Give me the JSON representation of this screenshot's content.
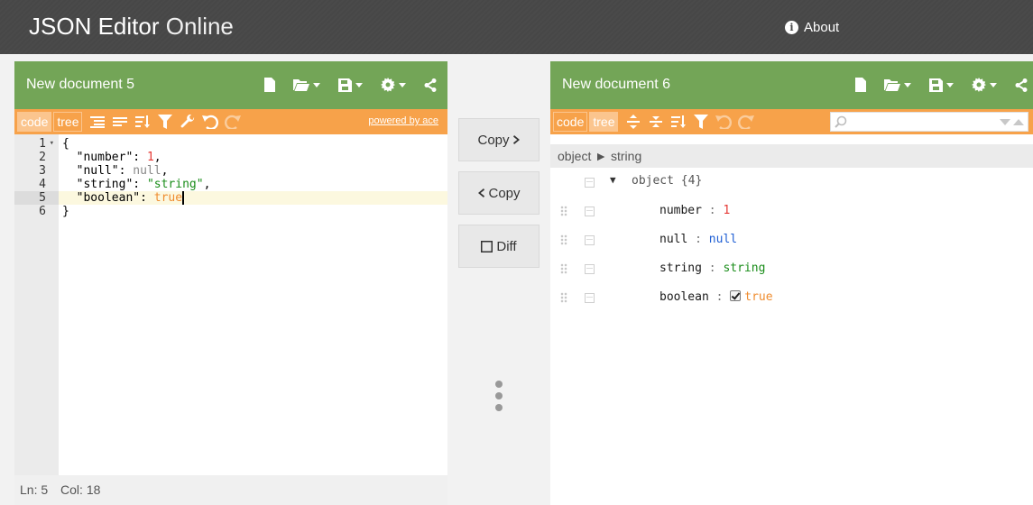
{
  "app": {
    "title_bold": "JSON Editor",
    "title_light": "Online",
    "about_label": "About",
    "info_icon": "info-circle-icon"
  },
  "colors": {
    "header_bg": "#4a4a4a",
    "titlebar_green": "#73a557",
    "toolbar_orange": "#f7a24a",
    "panel_bg": "#f2f2f2"
  },
  "left": {
    "doc_title": "New document 5",
    "toolbar_icons": [
      "new-document-icon",
      "open-folder-icon",
      "save-icon",
      "settings-icon",
      "share-icon"
    ],
    "modes": {
      "code": "code",
      "tree": "tree"
    },
    "tools": [
      "format-icon",
      "compact-icon",
      "sort-icon",
      "filter-icon",
      "repair-icon",
      "undo-icon",
      "redo-icon"
    ],
    "powered_by": "powered by ace",
    "code_lines": [
      {
        "num": "1",
        "text": "{"
      },
      {
        "num": "2",
        "key": "\"number\"",
        "value": "1"
      },
      {
        "num": "3",
        "key": "\"null\"",
        "value": "null"
      },
      {
        "num": "4",
        "key": "\"string\"",
        "value": "\"string\""
      },
      {
        "num": "5",
        "key": "\"boolean\"",
        "value": "true"
      },
      {
        "num": "6",
        "text": "}"
      }
    ],
    "status": {
      "line": "Ln: 5",
      "col": "Col: 18"
    }
  },
  "middle": {
    "copy_right": "Copy",
    "copy_left": "Copy",
    "diff": "Diff"
  },
  "right": {
    "doc_title": "New document 6",
    "toolbar_icons": [
      "new-document-icon",
      "open-folder-icon",
      "save-icon",
      "settings-icon",
      "share-icon"
    ],
    "modes": {
      "code": "code",
      "tree": "tree"
    },
    "tools": [
      "expand-all-icon",
      "collapse-all-icon",
      "sort-icon",
      "filter-icon",
      "undo-icon",
      "redo-icon"
    ],
    "search": {
      "placeholder": ""
    },
    "breadcrumb": {
      "root": "object",
      "arrow": "►",
      "leaf": "string"
    },
    "tree": {
      "root_label": "object",
      "root_count": "{4}",
      "rows": [
        {
          "field": "number",
          "value": "1",
          "type": "number"
        },
        {
          "field": "null",
          "value": "null",
          "type": "null"
        },
        {
          "field": "string",
          "value": "string",
          "type": "string"
        },
        {
          "field": "boolean",
          "value": "true",
          "type": "boolean"
        }
      ]
    }
  }
}
